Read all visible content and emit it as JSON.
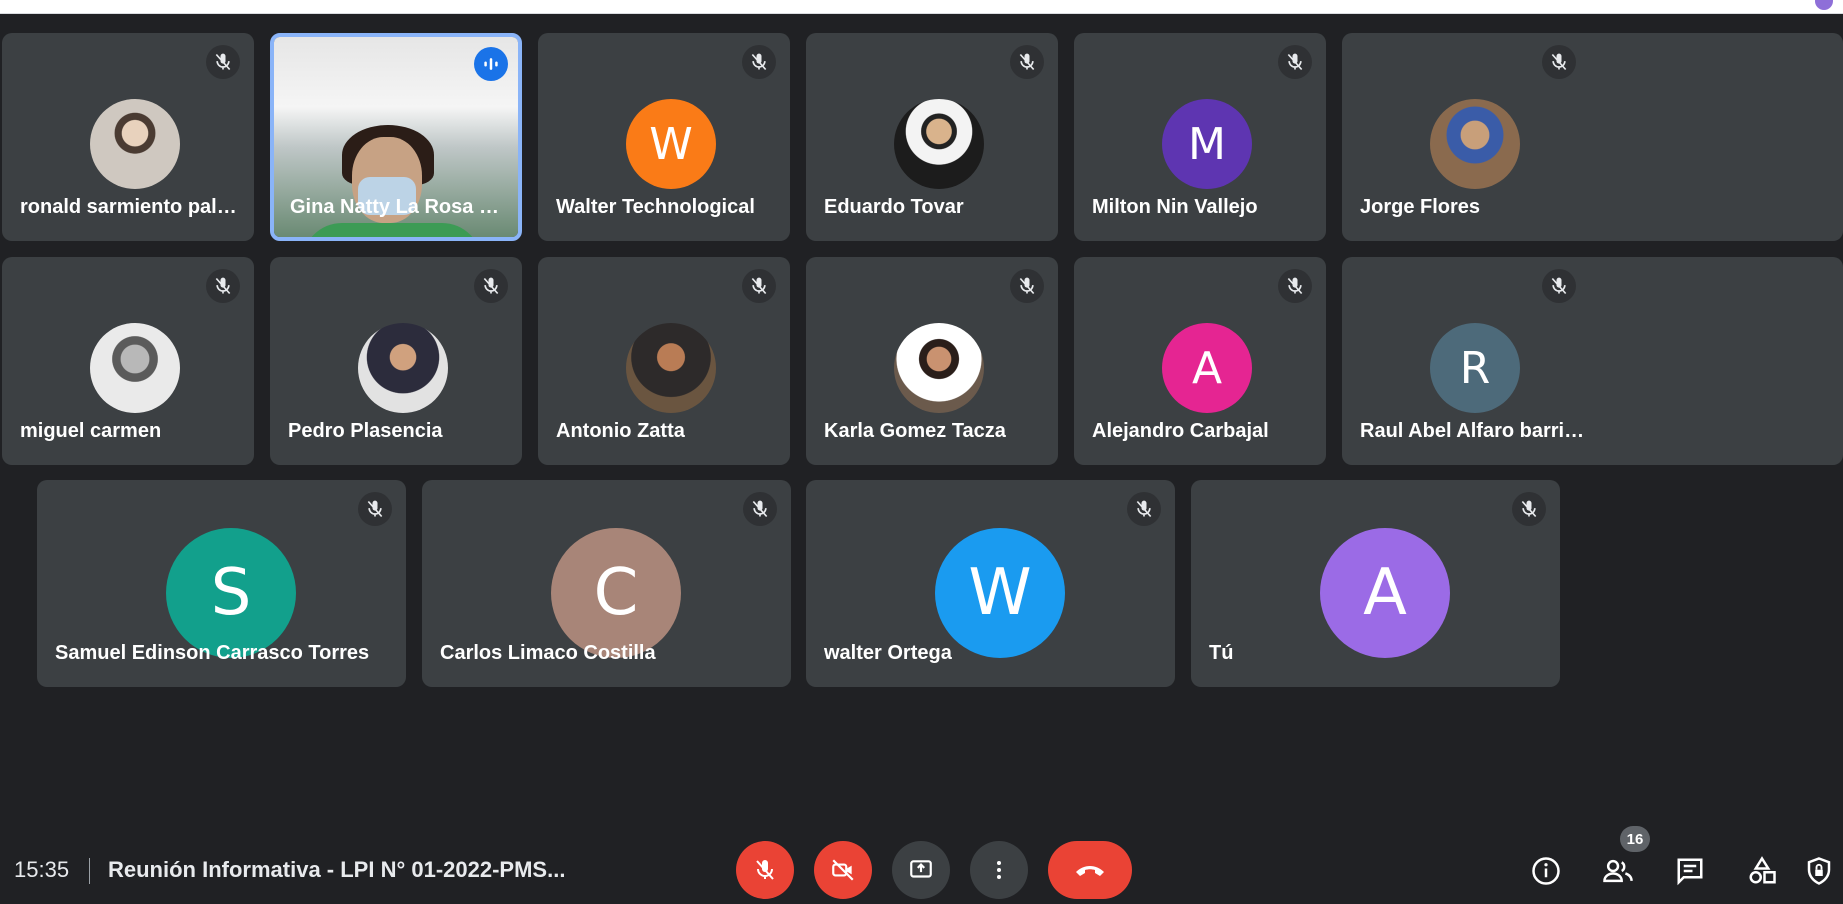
{
  "participants": [
    {
      "name": "ronald sarmiento palomi...",
      "avatar": "photo"
    },
    {
      "name": "Gina Natty La Rosa Ma...",
      "avatar": "video",
      "speaking": true
    },
    {
      "name": "Walter Technological",
      "initial": "W",
      "color": "#fa7b17"
    },
    {
      "name": "Eduardo Tovar",
      "avatar": "photo"
    },
    {
      "name": "Milton Nin Vallejo",
      "initial": "M",
      "color": "#5e35b1"
    },
    {
      "name": "Jorge Flores",
      "avatar": "photo"
    },
    {
      "name": "miguel carmen",
      "avatar": "photo"
    },
    {
      "name": "Pedro Plasencia",
      "avatar": "photo"
    },
    {
      "name": "Antonio Zatta",
      "avatar": "photo"
    },
    {
      "name": "Karla Gomez Tacza",
      "avatar": "photo"
    },
    {
      "name": "Alejandro Carbajal",
      "initial": "A",
      "color": "#e52592"
    },
    {
      "name": "Raul Abel Alfaro barrient...",
      "initial": "R",
      "color": "#4d6a7a"
    },
    {
      "name": "Samuel Edinson Carrasco Torres",
      "initial": "S",
      "color": "#12a08c"
    },
    {
      "name": "Carlos Limaco Costilla",
      "initial": "C",
      "color": "#a88578"
    },
    {
      "name": "walter Ortega",
      "initial": "W",
      "color": "#1a9bf0"
    },
    {
      "name": "Tú",
      "initial": "A",
      "color": "#9b6be6"
    }
  ],
  "bottom_bar": {
    "time": "15:35",
    "meeting_title": "Reunión Informativa - LPI N° 01-2022-PMS...",
    "participant_count": "16",
    "controls": [
      "microphone-off-icon",
      "camera-off-icon",
      "present-screen-icon",
      "more-options-icon",
      "hang-up-icon"
    ],
    "right_icons": [
      "info-icon",
      "people-icon",
      "chat-icon",
      "activities-icon",
      "host-controls-icon"
    ]
  },
  "colors": {
    "background": "#202124",
    "tile": "#3c4043",
    "danger": "#ea4335",
    "active_border": "#8ab4f8"
  }
}
